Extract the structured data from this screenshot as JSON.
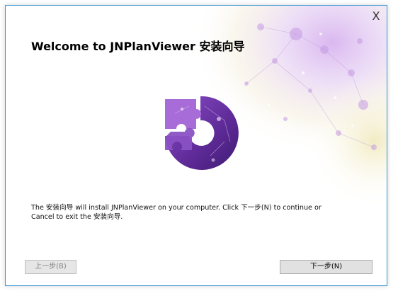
{
  "window": {
    "close_glyph": "X"
  },
  "header": {
    "title": "Welcome to JNPlanViewer 安装向导"
  },
  "body": {
    "line1": "The 安装向导 will install JNPlanViewer on your computer. Click 下一步(N) to continue or",
    "line2": "Cancel to exit the 安装向导."
  },
  "buttons": {
    "back_label": "上一步(B)",
    "back_enabled": false,
    "next_label": "下一步(N)"
  },
  "colors": {
    "border": "#3c97d6",
    "logo_purple": "#6a2fa3",
    "logo_light": "#a86cd8"
  },
  "icons": {
    "logo": "puzzle-piece-logo",
    "close": "close-icon"
  }
}
